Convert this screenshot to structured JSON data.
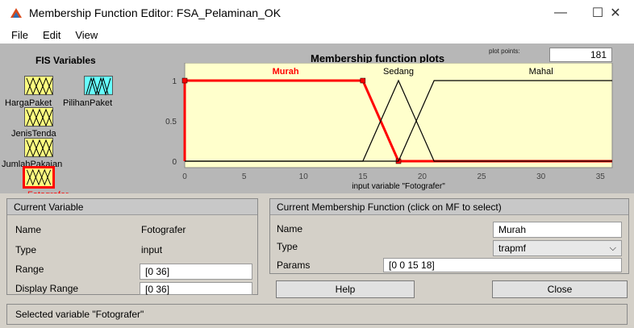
{
  "window": {
    "title": "Membership Function Editor: FSA_Pelaminan_OK",
    "minimize": "—",
    "maximize": "☐",
    "close": "✕"
  },
  "menu": [
    "File",
    "Edit",
    "View"
  ],
  "fis": {
    "title": "FIS Variables",
    "variables": [
      "HargaPaket",
      "PilihanPaket",
      "JenisTenda",
      "JumlahPakaian",
      "Fotografer"
    ]
  },
  "plot": {
    "title": "Membership function plots",
    "points_label": "plot points:",
    "points_value": "181",
    "xlabel": "input variable \"Fotografer\"",
    "x_ticks": [
      "0",
      "5",
      "10",
      "15",
      "20",
      "25",
      "30",
      "35"
    ],
    "y_ticks": [
      "1",
      "0.5",
      "0"
    ]
  },
  "chart_data": {
    "type": "line",
    "xlabel": "input variable \"Fotografer\"",
    "xlim": [
      0,
      36
    ],
    "ylim": [
      0,
      1
    ],
    "series": [
      {
        "name": "Murah",
        "x": [
          0,
          0,
          15,
          18,
          36
        ],
        "values": [
          0,
          1,
          1,
          0,
          0
        ],
        "highlight": true
      },
      {
        "name": "Sedang",
        "x": [
          0,
          15,
          18,
          21,
          36
        ],
        "values": [
          0,
          0,
          1,
          0,
          0
        ],
        "highlight": false
      },
      {
        "name": "Mahal",
        "x": [
          0,
          18,
          21,
          36
        ],
        "values": [
          0,
          0,
          1,
          1
        ],
        "highlight": false
      }
    ],
    "colors": {
      "background": "#ffffcc",
      "selected": "#ff0000",
      "normal": "#000000",
      "selected_label": "#ff0000"
    }
  },
  "current_variable": {
    "header": "Current Variable",
    "name_label": "Name",
    "name_value": "Fotografer",
    "type_label": "Type",
    "type_value": "input",
    "range_label": "Range",
    "range_value": "[0 36]",
    "display_label": "Display Range",
    "display_value": "[0 36]"
  },
  "current_mf": {
    "header": "Current Membership Function (click on MF to select)",
    "name_label": "Name",
    "name_value": "Murah",
    "type_label": "Type",
    "type_value": "trapmf",
    "params_label": "Params",
    "params_value": "[0 0 15 18]"
  },
  "buttons": {
    "help": "Help",
    "close": "Close"
  },
  "status": "Selected variable \"Fotografer\""
}
